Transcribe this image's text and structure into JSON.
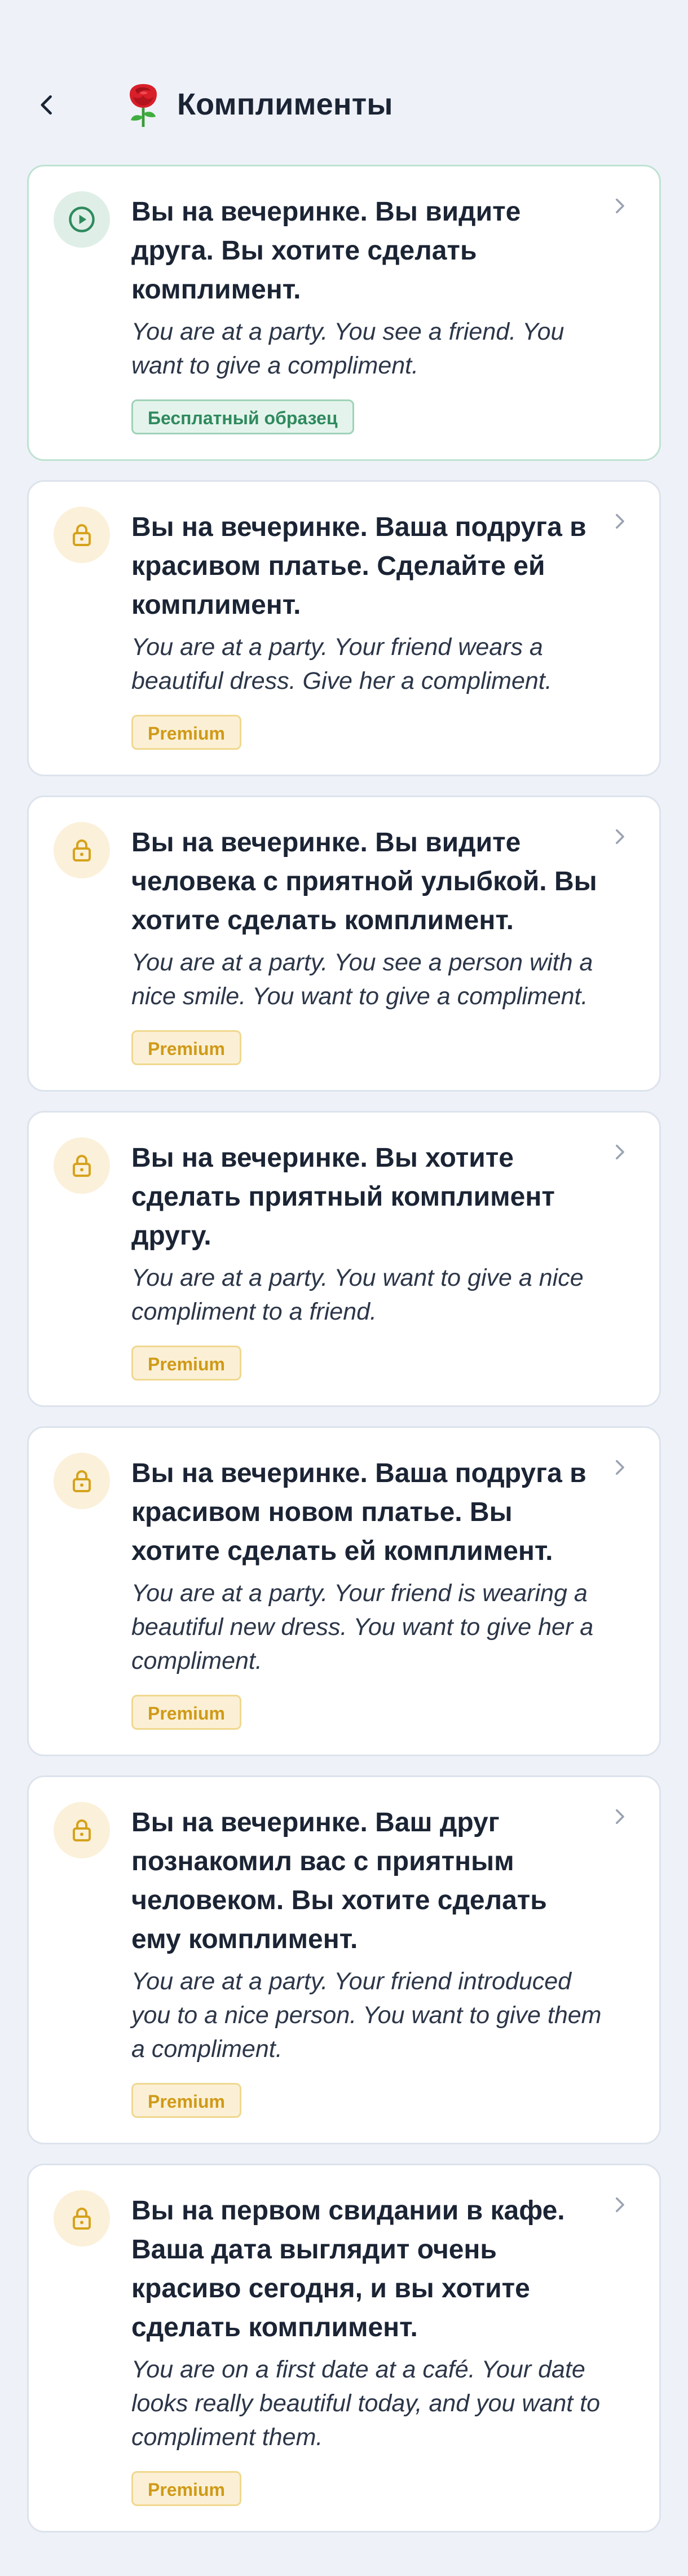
{
  "header": {
    "title": "Комплименты",
    "back_icon": "chevron-left-icon",
    "title_icon": "rose-icon"
  },
  "colors": {
    "background": "#eef2f8",
    "free_accent": "#2f8a5e",
    "premium_accent": "#d09a17"
  },
  "cards": [
    {
      "ru": "Вы на вечеринке. Вы видите друга. Вы хотите сделать комплимент.",
      "en": "You are at a party. You see a friend. You want to give a compliment.",
      "badge": "Бесплатный образец",
      "status_icon": "play-icon",
      "locked": false
    },
    {
      "ru": "Вы на вечеринке. Ваша подруга в красивом платье. Сделайте ей комплимент.",
      "en": "You are at a party. Your friend wears a beautiful dress. Give her a compliment.",
      "badge": "Premium",
      "status_icon": "lock-icon",
      "locked": true
    },
    {
      "ru": "Вы на вечеринке. Вы видите человека с приятной улыбкой. Вы хотите сделать комплимент.",
      "en": "You are at a party. You see a person with a nice smile. You want to give a compliment.",
      "badge": "Premium",
      "status_icon": "lock-icon",
      "locked": true
    },
    {
      "ru": "Вы на вечеринке. Вы хотите сделать приятный комплимент другу.",
      "en": "You are at a party. You want to give a nice compliment to a friend.",
      "badge": "Premium",
      "status_icon": "lock-icon",
      "locked": true
    },
    {
      "ru": "Вы на вечеринке. Ваша подруга в красивом новом платье. Вы хотите сделать ей комплимент.",
      "en": "You are at a party. Your friend is wearing a beautiful new dress. You want to give her a compliment.",
      "badge": "Premium",
      "status_icon": "lock-icon",
      "locked": true
    },
    {
      "ru": "Вы на вечеринке. Ваш друг познакомил вас с приятным человеком. Вы хотите сделать ему комплимент.",
      "en": "You are at a party. Your friend introduced you to a nice person. You want to give them a compliment.",
      "badge": "Premium",
      "status_icon": "lock-icon",
      "locked": true
    },
    {
      "ru": "Вы на первом свидании в кафе. Ваша дата выглядит очень красиво сегодня, и вы хотите сделать комплимент.",
      "en": "You are on a first date at a café. Your date looks really beautiful today, and you want to compliment them.",
      "badge": "Premium",
      "status_icon": "lock-icon",
      "locked": true
    }
  ]
}
